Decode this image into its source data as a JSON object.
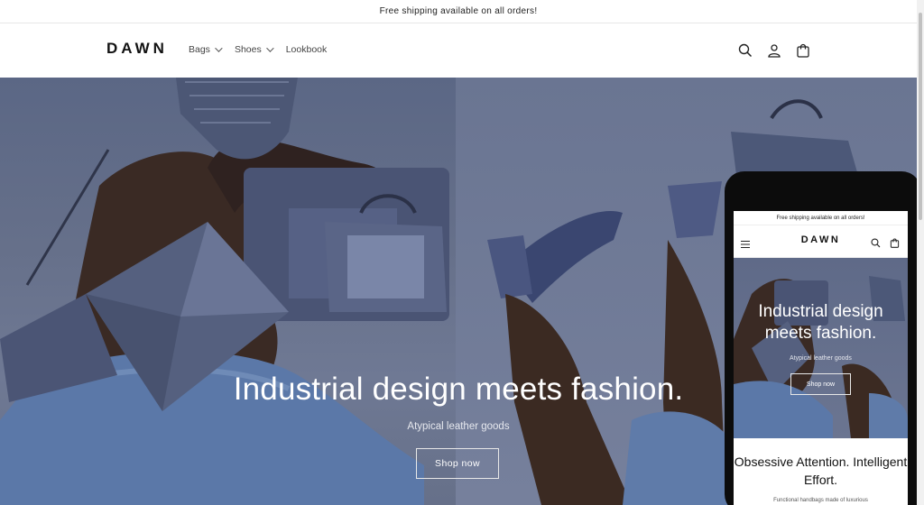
{
  "announcement": "Free shipping available on all orders!",
  "header": {
    "logo": "DAWN",
    "nav": [
      {
        "label": "Bags",
        "has_dropdown": true
      },
      {
        "label": "Shoes",
        "has_dropdown": true
      },
      {
        "label": "Lookbook",
        "has_dropdown": false
      }
    ],
    "icons": [
      "search-icon",
      "account-icon",
      "cart-icon"
    ]
  },
  "hero": {
    "heading": "Industrial design meets fashion.",
    "subheading": "Atypical leather goods",
    "button": "Shop now"
  },
  "mobile": {
    "announcement": "Free shipping available on all orders!",
    "logo": "DAWN",
    "hero_heading": "Industrial design meets fashion.",
    "hero_subheading": "Atypical leather goods",
    "hero_button": "Shop now",
    "section_heading": "Obsessive Attention. Intelligent Effort.",
    "section_text": "Functional handbags made of luxurious"
  },
  "colors": {
    "text": "#121212",
    "hero_bg": "#66708a",
    "phone_frame": "#0c0c0c"
  }
}
